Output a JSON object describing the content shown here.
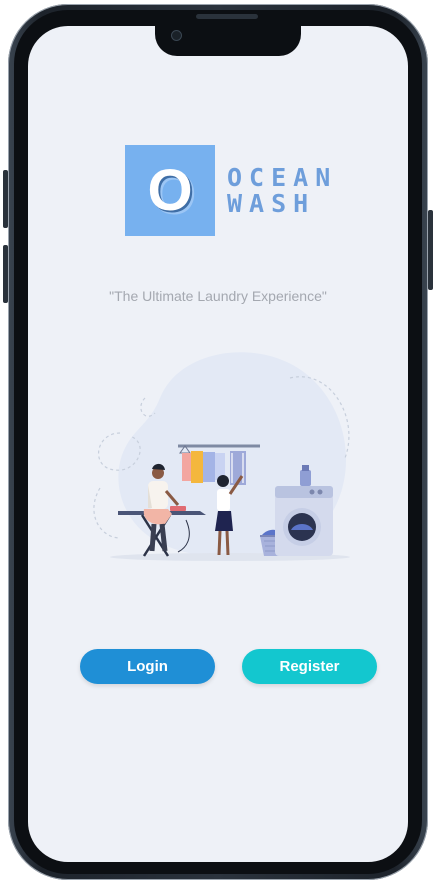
{
  "app": {
    "logo_letter": "O",
    "logo_line1": "OCEAN",
    "logo_line2": "WASH",
    "tagline": "\"The Ultimate Laundry Experience\""
  },
  "illustration": {
    "name": "laundry-scene"
  },
  "actions": {
    "login_label": "Login",
    "register_label": "Register"
  },
  "colors": {
    "screen_background": "#eef1f7",
    "logo_block": "#77b1ef",
    "logo_text": "#6e9edb",
    "login_button": "#1f8fd6",
    "register_button": "#13c7cf",
    "tagline_text": "#a4a8b0"
  }
}
